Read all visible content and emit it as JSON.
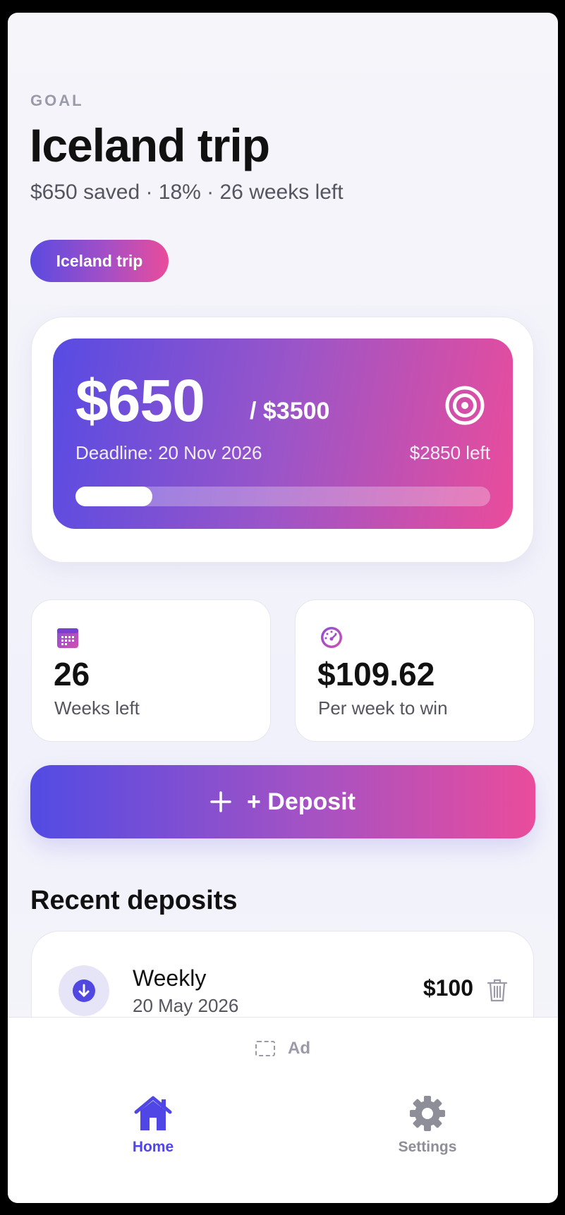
{
  "header": {
    "eyebrow": "GOAL",
    "title": "Iceland trip",
    "subtitle": "$650 saved · 18% · 26 weeks left"
  },
  "goal_chip": {
    "label": "Iceland trip"
  },
  "hero": {
    "amount": "$650",
    "goal": "/ $3500",
    "deadline": "Deadline: 20 Nov 2026",
    "remaining": "$2850 left",
    "progress_fraction": 0.186,
    "icon": "target-icon"
  },
  "stats": [
    {
      "icon": "calendar-icon",
      "value": "26",
      "label": "Weeks left"
    },
    {
      "icon": "speedometer-icon",
      "value": "$109.62",
      "label": "Per week to win"
    }
  ],
  "deposit_button": {
    "icon": "plus-icon",
    "label": "+ Deposit"
  },
  "recent": {
    "title": "Recent deposits",
    "items": [
      {
        "icon": "arrow-down-icon",
        "title": "Weekly",
        "date": "20 May 2026",
        "amount": "$100",
        "action_icon": "trash-icon"
      }
    ]
  },
  "ad": {
    "label": "Ad"
  },
  "tabs": [
    {
      "icon": "home-icon",
      "label": "Home",
      "active": true
    },
    {
      "icon": "gear-icon",
      "label": "Settings",
      "active": false
    }
  ],
  "colors": {
    "accent": "#4f46e5",
    "gradient_start": "#574be3",
    "gradient_end": "#ea4c9b",
    "muted_text": "#55555f"
  }
}
